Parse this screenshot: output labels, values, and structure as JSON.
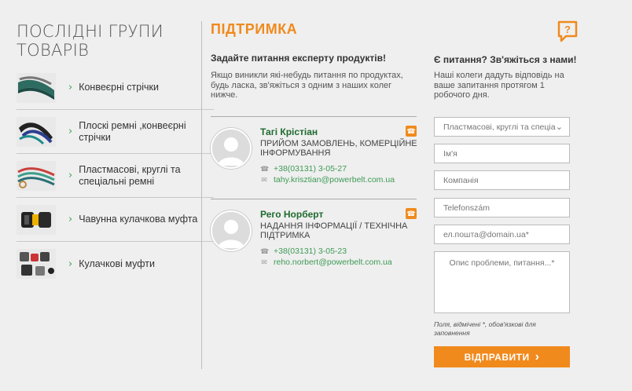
{
  "left": {
    "title": "ПОСЛІДНІ ГРУПИ ТОВАРІВ",
    "chevron": "›",
    "groups": [
      {
        "label": "Конвеєрні стрічки",
        "icon": "conveyor-belt-thumb"
      },
      {
        "label": "Плоскі ремні ,конвеєрні стрічки",
        "icon": "flat-belt-thumb"
      },
      {
        "label": "Пластмасові, круглі та спеціальні ремні",
        "icon": "round-belt-thumb"
      },
      {
        "label": "Чавунна кулачкова муфта",
        "icon": "cast-iron-coupling-thumb"
      },
      {
        "label": "Кулачкові муфти",
        "icon": "jaw-coupling-thumb"
      }
    ]
  },
  "middle": {
    "title": "ПІДТРИМКА",
    "subtitle": "Задайте питання експерту продуктів!",
    "description": "Якщо виникли які-небудь питання по продуктах, будь ласка, зв'яжіться з одним з наших колег нижче.",
    "contacts": [
      {
        "name": "Тагі Крістіан",
        "role": "ПРИЙОМ ЗАМОВЛЕНЬ, КОМЕРЦІЙНЕ ІНФОРМУВАННЯ",
        "phone": "+38(03131) 3-05-27",
        "email": "tahy.krisztian@powerbelt.com.ua"
      },
      {
        "name": "Рего Норберт",
        "role": "НАДАННЯ ІНФОРМАЦІЇ / ТЕХНІЧНА ПІДТРИМКА",
        "phone": "+38(03131) 3-05-23",
        "email": "reho.norbert@powerbelt.com.ua"
      }
    ],
    "icons": {
      "phone": "☎",
      "email": "✉",
      "call": "☎"
    }
  },
  "right": {
    "title": "Є питання? Зв'яжіться з нами!",
    "description": "Наші колеги дадуть відповідь на ваше запитання протягом 1 робочого дня.",
    "select_value": "Пластмасові, круглі та спеціа",
    "select_arrow": "⌄",
    "name_placeholder": "Ім'я",
    "company_placeholder": "Компанія",
    "phone_placeholder": "Telefonszám",
    "email_placeholder": "ел.пошта@domain.ua*",
    "message_placeholder": "Опис проблеми, питання...*",
    "required_note": "Поля, відмічені *, обов'язкові для заповнення",
    "submit_label": "ВІДПРАВИТИ",
    "submit_chevron": "›",
    "help_icon": "question-chat-icon"
  },
  "colors": {
    "accent": "#f08a1c",
    "name_green": "#1e6b2e",
    "link_green": "#3d9a55",
    "background": "#efefef"
  }
}
